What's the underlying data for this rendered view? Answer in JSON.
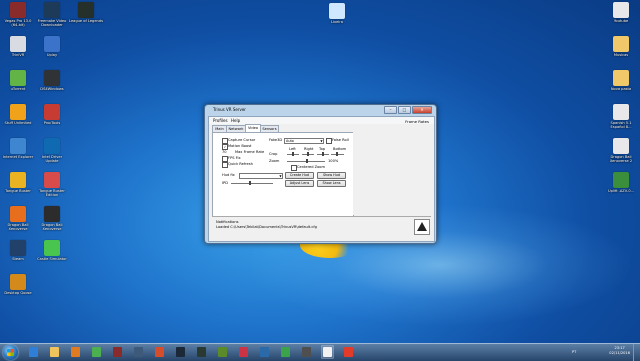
{
  "desktop_icons_left": [
    {
      "label": "Vegas Pro 13.0 (64-bit)",
      "color": "#8a2b2b",
      "col": 0,
      "row": 0
    },
    {
      "label": "Freemake Video Downloader",
      "color": "#1d3b58",
      "col": 1,
      "row": 0
    },
    {
      "label": "League of Legends",
      "color": "#26302b",
      "col": 2,
      "row": 0
    },
    {
      "label": "TriniVR",
      "color": "#d8dce2",
      "col": 0,
      "row": 1
    },
    {
      "label": "Uplay",
      "color": "#3a73c9",
      "col": 1,
      "row": 1
    },
    {
      "label": "uTorrent",
      "color": "#63b446",
      "col": 0,
      "row": 2
    },
    {
      "label": "DS4Windows",
      "color": "#2f3336",
      "col": 1,
      "row": 2
    },
    {
      "label": "Stuff Unlimited",
      "color": "#f0a21a",
      "col": 0,
      "row": 3
    },
    {
      "label": "ProcTools",
      "color": "#c73c32",
      "col": 1,
      "row": 3
    },
    {
      "label": "Internet Explorer",
      "color": "#3f86d1",
      "col": 0,
      "row": 4
    },
    {
      "label": "Intel Driver Update",
      "color": "#0f6ab1",
      "col": 1,
      "row": 4
    },
    {
      "label": "Tongue Buster",
      "color": "#e9b321",
      "col": 0,
      "row": 5
    },
    {
      "label": "Tongue Buster Edition",
      "color": "#d84b4b",
      "col": 1,
      "row": 5
    },
    {
      "label": "Dragon Ball Xenoverse",
      "color": "#e76e1d",
      "col": 0,
      "row": 6
    },
    {
      "label": "Dragon Ball Xenoverse",
      "color": "#2c2c2c",
      "col": 1,
      "row": 6
    },
    {
      "label": "Steam",
      "color": "#21406a",
      "col": 0,
      "row": 7
    },
    {
      "label": "Castle Simulator",
      "color": "#49c44f",
      "col": 1,
      "row": 7
    },
    {
      "label": "Desktop Goose",
      "color": "#d48a1b",
      "col": 0,
      "row": 8
    }
  ],
  "desktop_icons_right": [
    {
      "label": "Youtube",
      "color": "#e8e8ea",
      "row": 0
    },
    {
      "label": "Musicas",
      "color": "#f0c86a",
      "row": 1
    },
    {
      "label": "Nova pasta",
      "color": "#f0c86a",
      "row": 2
    },
    {
      "label": "Spanish 5.1 Español 8...",
      "color": "#e8e8ea",
      "row": 3
    },
    {
      "label": "Dragon Ball Xenoverse 2",
      "color": "#e8e8ea",
      "row": 4
    },
    {
      "label": "Uplift -AZV-0...",
      "color": "#3b8e3b",
      "row": 5
    }
  ],
  "recycle_bin": {
    "label": "Lixeira",
    "color": "#cfe7ff"
  },
  "window": {
    "title": "Trinus VR Server",
    "minimize_glyph": "–",
    "maximize_glyph": "□",
    "close_glyph": "✕",
    "menu": [
      "Profiles",
      "Help"
    ],
    "frame_rates_label": "Frame Rates",
    "tabs": [
      "Main",
      "Network",
      "Video",
      "Sensors"
    ],
    "active_tab": "Video",
    "video": {
      "capture_cursor_label": "Capture Cursor",
      "motion_boost_label": "Motion Boost",
      "motion_boost_checked": "✓",
      "fps_value": "70",
      "max_frame_rate_label": "Max Frame Rate",
      "fps_fix_label": "FPS Fix",
      "quick_refresh_label": "Quick Refresh",
      "fake3d_label": "Fake3D",
      "fake3d_value": "Auto",
      "false_roll_label": "False Roll",
      "crop_label": "Crop",
      "left_label": "Left",
      "right_label": "Right",
      "top_label": "Top",
      "bottom_label": "Bottom",
      "zoom_label": "Zoom",
      "zoom_percent": "100%",
      "centered_zoom_label": "Centered Zoom",
      "hud_label": "Hud fix",
      "hud_value": "",
      "create_hud": "Create Hud",
      "show_hud": "Show Hud",
      "ipd_label": "IPD",
      "adjust_lens": "Adjust Lens",
      "show_lens": "Show Lens"
    },
    "notifications_label": "Notifications",
    "notification_text": "Loaded C:\\Users\\Tekilat\\Documents\\TrinusVR\\default.cfg"
  },
  "taskbar": {
    "apps": [
      {
        "name": "ie",
        "color": "#2f7fd6"
      },
      {
        "name": "explorer",
        "color": "#f1c35c"
      },
      {
        "name": "media",
        "color": "#e07b22"
      },
      {
        "name": "chrome",
        "color": "#4caf50"
      },
      {
        "name": "vegas",
        "color": "#8a2b2b"
      },
      {
        "name": "app6",
        "color": "#3d5a7a"
      },
      {
        "name": "app7",
        "color": "#d54d2a"
      },
      {
        "name": "steam",
        "color": "#1b2838"
      },
      {
        "name": "lol",
        "color": "#2a3a33"
      },
      {
        "name": "app10",
        "color": "#5a8a2a"
      },
      {
        "name": "app11",
        "color": "#cc3344"
      },
      {
        "name": "app12",
        "color": "#2a6aa8"
      },
      {
        "name": "app13",
        "color": "#3ba34a"
      },
      {
        "name": "app14",
        "color": "#4f4f4f"
      },
      {
        "name": "trinus",
        "color": "#f2f2f2"
      },
      {
        "name": "app16",
        "color": "#e23b2a"
      }
    ],
    "time": "23:17",
    "date": "02/11/2016",
    "lang": "PT"
  }
}
